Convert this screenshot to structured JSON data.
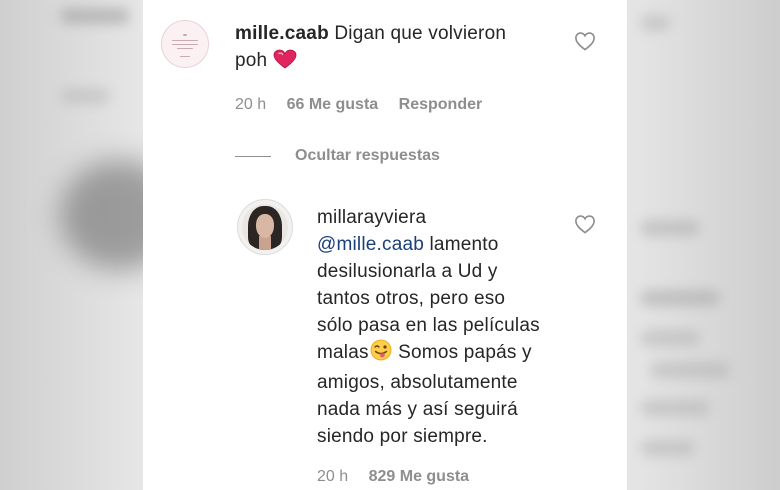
{
  "comment": {
    "username": "mille.caab",
    "text_line1": "Digan que volvieron",
    "text_line2": "poh",
    "emoji": "heart-emoji",
    "time": "20 h",
    "likes": "66 Me gusta",
    "reply_label": "Responder"
  },
  "replies_toggle": {
    "label": "Ocultar respuestas"
  },
  "reply": {
    "username": "millarayviera",
    "mention": "@mille.caab",
    "lines": [
      " lamento",
      "desilusionarla a Ud y",
      "tantos otros, pero eso",
      "sólo pasa en las películas",
      "malas",
      " Somos papás y",
      "amigos, absolutamente",
      "nada más y así seguirá",
      "siendo por siempre."
    ],
    "emoji": "winking-tongue-emoji",
    "time": "20 h",
    "likes": "829 Me gusta"
  },
  "icons": {
    "like": "heart-outline-icon"
  },
  "colors": {
    "text": "#262626",
    "meta": "#8e8e8e",
    "mention": "#1b3f7a",
    "emoji_heart": "#e0245e"
  }
}
